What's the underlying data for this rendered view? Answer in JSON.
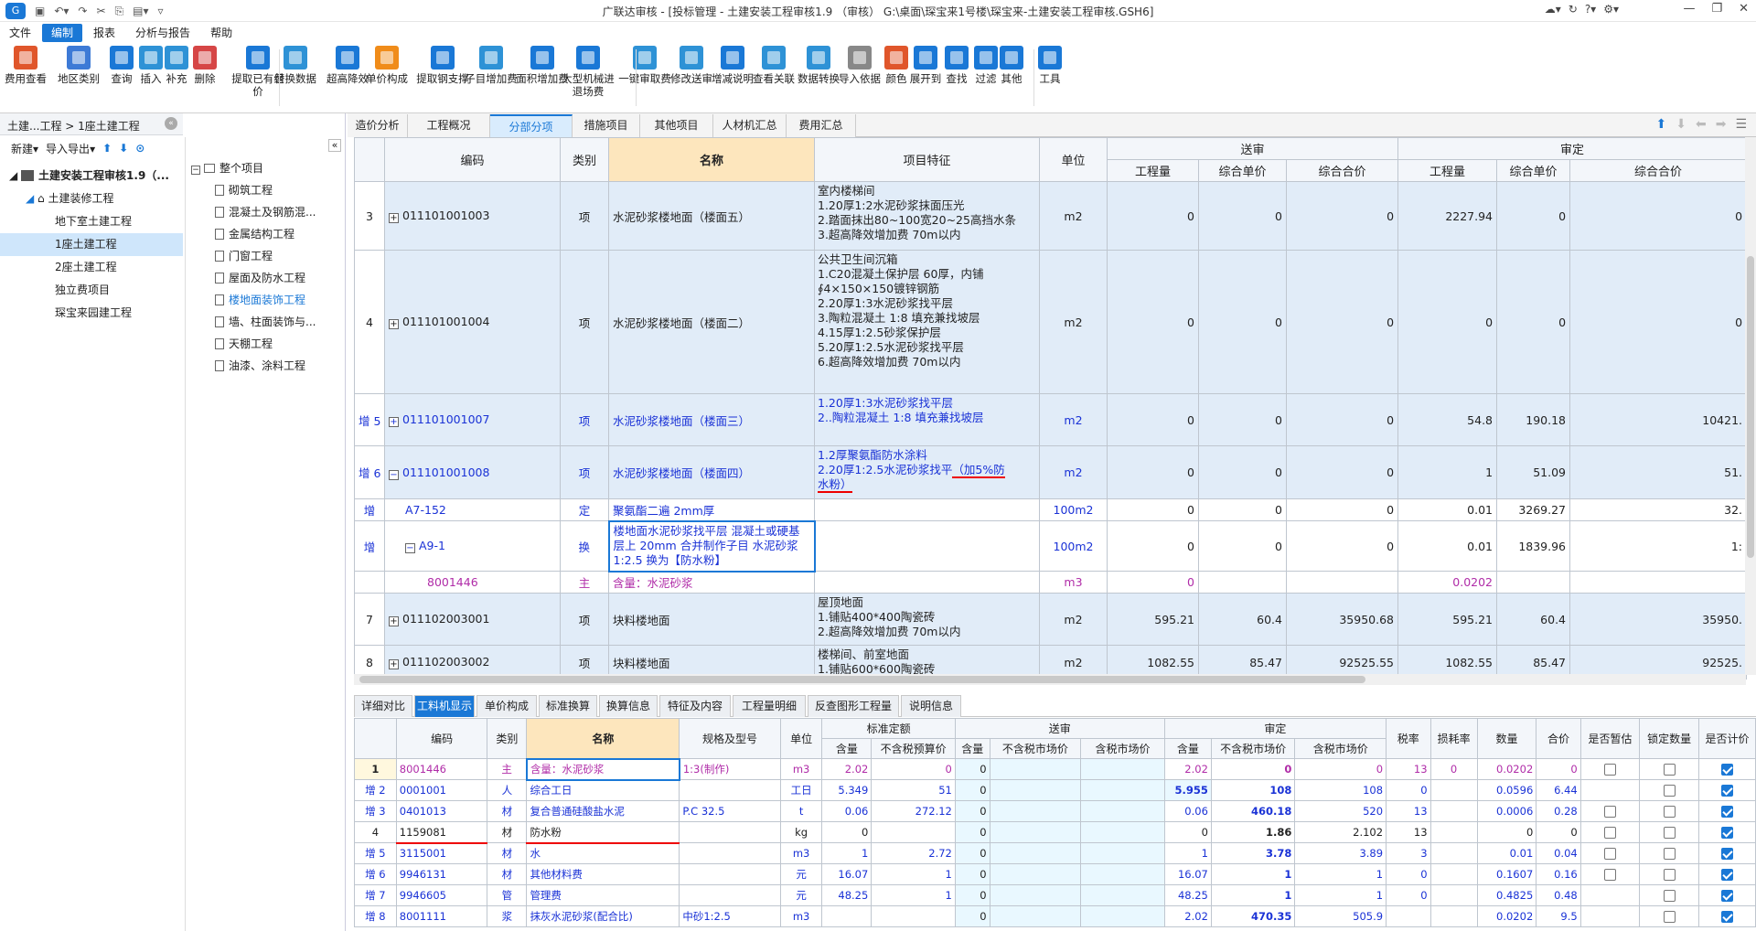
{
  "window": {
    "title": "广联达审核 - [投标管理 - 土建安装工程审核1.9 （审核） G:\\桌面\\琛宝来1号楼\\琛宝来-土建安装工程审核.GSH6]"
  },
  "menu": [
    "文件",
    "编制",
    "报表",
    "分析与报告",
    "帮助"
  ],
  "ribbon": [
    "费用查看",
    "地区类别",
    "查询",
    "插入",
    "补充",
    "删除",
    "提取已有组价",
    "替换数据",
    "超高降效",
    "单价构成",
    "提取钢支撑",
    "子目增加费",
    "面积增加费",
    "大型机械进退场费",
    "一键审取费",
    "修改送审",
    "增减说明",
    "查看关联",
    "数据转换",
    "导入依据",
    "颜色",
    "展开到",
    "查找",
    "过滤",
    "其他",
    "工具"
  ],
  "breadcrumb": "土建...工程 > 1座土建工程",
  "lefttool": {
    "new": "新建",
    "import": "导入导出"
  },
  "tree": [
    {
      "label": "土建安装工程审核1.9（...",
      "level": 0,
      "bold": true
    },
    {
      "label": "土建装修工程",
      "level": 1
    },
    {
      "label": "地下室土建工程",
      "level": 2
    },
    {
      "label": "1座土建工程",
      "level": 2,
      "sel": true
    },
    {
      "label": "2座土建工程",
      "level": 2
    },
    {
      "label": "独立费项目",
      "level": 2
    },
    {
      "label": "琛宝来园建工程",
      "level": 2
    }
  ],
  "tree2": [
    {
      "label": "整个项目",
      "root": true
    },
    {
      "label": "砌筑工程"
    },
    {
      "label": "混凝土及钢筋混..."
    },
    {
      "label": "金属结构工程"
    },
    {
      "label": "门窗工程"
    },
    {
      "label": "屋面及防水工程"
    },
    {
      "label": "楼地面装饰工程",
      "active": true
    },
    {
      "label": "墙、柱面装饰与..."
    },
    {
      "label": "天棚工程"
    },
    {
      "label": "油漆、涂料工程"
    }
  ],
  "tabs": [
    "造价分析",
    "工程概况",
    "分部分项",
    "措施项目",
    "其他项目",
    "人材机汇总",
    "费用汇总"
  ],
  "grid": {
    "headers": {
      "code": "编码",
      "type": "类别",
      "name": "名称",
      "feature": "项目特征",
      "unit": "单位",
      "sent": "送审",
      "approved": "审定",
      "qty": "工程量",
      "uprice": "综合单价",
      "total": "综合合价"
    },
    "rows": [
      {
        "no": "3",
        "code": "011101001003",
        "type": "项",
        "name": "水泥砂浆楼地面（楼面五）",
        "feature": "室内楼梯间\n1.20厚1:2水泥砂浆抹面压光\n2.踏面抹出80~100宽20~25高挡水条\n3.超高降效增加费 70m以内",
        "unit": "m2",
        "s": [
          "0",
          "0",
          "0"
        ],
        "a": [
          "2227.94",
          "0",
          "0"
        ]
      },
      {
        "no": "4",
        "code": "011101001004",
        "type": "项",
        "name": "水泥砂浆楼地面（楼面二）",
        "feature": "公共卫生间沉箱\n1.C20混凝土保护层 60厚，内铺\n∮4×150×150镀锌钢筋\n2.20厚1:3水泥砂浆找平层\n3.陶粒混凝土 1:8 填充兼找坡层\n4.15厚1:2.5砂浆保护层\n5.20厚1:2.5水泥砂浆找平层\n6.超高降效增加费 70m以内",
        "unit": "m2",
        "s": [
          "0",
          "0",
          "0"
        ],
        "a": [
          "0",
          "0",
          "0"
        ]
      },
      {
        "no": "增 5",
        "code": "011101001007",
        "type": "项",
        "name": "水泥砂浆楼地面（楼面三）",
        "feature": "1.20厚1:3水泥砂浆找平层\n2..陶粒混凝土 1:8 填充兼找坡层",
        "unit": "m2",
        "s": [
          "0",
          "0",
          "0"
        ],
        "a": [
          "54.8",
          "190.18",
          "10421."
        ]
      },
      {
        "no": "增 6",
        "code": "011101001008",
        "type": "项",
        "name": "水泥砂浆楼地面（楼面四）",
        "feature": "1.2厚聚氨酯防水涂料\n2.20厚1:2.5水泥砂浆找平（加5%防\n水粉）",
        "unit": "m2",
        "s": [
          "0",
          "0",
          "0"
        ],
        "a": [
          "1",
          "51.09",
          "51."
        ]
      },
      {
        "no": "增",
        "code": "A7-152",
        "type": "定",
        "name": "聚氨酯二遍 2mm厚",
        "feature": "",
        "unit": "100m2",
        "s": [
          "0",
          "0",
          "0"
        ],
        "a": [
          "0.01",
          "3269.27",
          "32."
        ]
      },
      {
        "no": "增",
        "code": "A9-1",
        "type": "换",
        "name": "楼地面水泥砂浆找平层 混凝土或硬基层上 20mm  合并制作子目 水泥砂浆 1:2.5  换为【防水粉】",
        "feature": "",
        "unit": "100m2",
        "s": [
          "0",
          "0",
          "0"
        ],
        "a": [
          "0.01",
          "1839.96",
          "1:"
        ]
      },
      {
        "no": "",
        "code": "8001446",
        "type": "主",
        "name": "含量：水泥砂浆",
        "feature": "",
        "unit": "m3",
        "s": [
          "0",
          "",
          ""
        ],
        "a": [
          "0.0202",
          "",
          ""
        ]
      },
      {
        "no": "7",
        "code": "011102003001",
        "type": "项",
        "name": "块料楼地面",
        "feature": "屋顶地面\n1.铺贴400*400陶瓷砖\n2.超高降效增加费 70m以内",
        "unit": "m2",
        "s": [
          "595.21",
          "60.4",
          "35950.68"
        ],
        "a": [
          "595.21",
          "60.4",
          "35950."
        ]
      },
      {
        "no": "8",
        "code": "011102003002",
        "type": "项",
        "name": "块料楼地面",
        "feature": "楼梯间、前室地面\n1.铺贴600*600陶瓷砖",
        "unit": "m2",
        "s": [
          "1082.55",
          "85.47",
          "92525.55"
        ],
        "a": [
          "1082.55",
          "85.47",
          "92525."
        ]
      }
    ]
  },
  "btabs": [
    "详细对比",
    "工料机显示",
    "单价构成",
    "标准换算",
    "换算信息",
    "特征及内容",
    "工程量明细",
    "反查图形工程量",
    "说明信息"
  ],
  "bgrid": {
    "headers": {
      "code": "编码",
      "type": "类别",
      "name": "名称",
      "spec": "规格及型号",
      "unit": "单位",
      "std": "标准定额",
      "sent": "送审",
      "appr": "审定",
      "qty": "含量",
      "ntprice": "不含税预算价",
      "ntm": "不含税市场价",
      "tm": "含税市场价",
      "tax": "税率",
      "loss": "损耗率",
      "amount": "数量",
      "sum": "合价",
      "temp": "是否暂估",
      "lock": "锁定数量",
      "calc": "是否计价"
    },
    "rows": [
      {
        "no": "1",
        "code": "8001446",
        "type": "主",
        "name": "含量：水泥砂浆",
        "spec": "1:3(制作)",
        "unit": "m3",
        "std": [
          "2.02",
          "0"
        ],
        "sent": [
          "0",
          "",
          ""
        ],
        "appr": [
          "2.02",
          "0",
          "0"
        ],
        "tax": "13",
        "loss": "0",
        "amount": "0.0202",
        "sum": "0",
        "temp": false,
        "lock": false,
        "calc": true,
        "style": "pur"
      },
      {
        "no": "增 2",
        "code": "0001001",
        "type": "人",
        "name": "综合工日",
        "spec": "",
        "unit": "工日",
        "std": [
          "5.349",
          "51"
        ],
        "sent": [
          "0",
          "",
          ""
        ],
        "appr": [
          "5.955",
          "108",
          "108"
        ],
        "tax": "0",
        "loss": "",
        "amount": "0.0596",
        "sum": "6.44",
        "temp": null,
        "lock": false,
        "calc": true,
        "style": "blue"
      },
      {
        "no": "增 3",
        "code": "0401013",
        "type": "材",
        "name": "复合普通硅酸盐水泥",
        "spec": "P.C 32.5",
        "unit": "t",
        "std": [
          "0.06",
          "272.12"
        ],
        "sent": [
          "0",
          "",
          ""
        ],
        "appr": [
          "0.06",
          "460.18",
          "520"
        ],
        "tax": "13",
        "loss": "",
        "amount": "0.0006",
        "sum": "0.28",
        "temp": false,
        "lock": false,
        "calc": true,
        "style": "blue"
      },
      {
        "no": "4",
        "code": "1159081",
        "type": "材",
        "name": "防水粉",
        "spec": "",
        "unit": "kg",
        "std": [
          "0",
          ""
        ],
        "sent": [
          "0",
          "",
          ""
        ],
        "appr": [
          "0",
          "1.86",
          "2.102"
        ],
        "tax": "13",
        "loss": "",
        "amount": "0",
        "sum": "0",
        "temp": false,
        "lock": false,
        "calc": true,
        "style": ""
      },
      {
        "no": "增 5",
        "code": "3115001",
        "type": "材",
        "name": "水",
        "spec": "",
        "unit": "m3",
        "std": [
          "1",
          "2.72"
        ],
        "sent": [
          "0",
          "",
          ""
        ],
        "appr": [
          "1",
          "3.78",
          "3.89"
        ],
        "tax": "3",
        "loss": "",
        "amount": "0.01",
        "sum": "0.04",
        "temp": false,
        "lock": false,
        "calc": true,
        "style": "blue"
      },
      {
        "no": "增 6",
        "code": "9946131",
        "type": "材",
        "name": "其他材料费",
        "spec": "",
        "unit": "元",
        "std": [
          "16.07",
          "1"
        ],
        "sent": [
          "0",
          "",
          ""
        ],
        "appr": [
          "16.07",
          "1",
          "1"
        ],
        "tax": "0",
        "loss": "",
        "amount": "0.1607",
        "sum": "0.16",
        "temp": false,
        "lock": false,
        "calc": true,
        "style": "blue"
      },
      {
        "no": "增 7",
        "code": "9946605",
        "type": "管",
        "name": "管理费",
        "spec": "",
        "unit": "元",
        "std": [
          "48.25",
          "1"
        ],
        "sent": [
          "0",
          "",
          ""
        ],
        "appr": [
          "48.25",
          "1",
          "1"
        ],
        "tax": "0",
        "loss": "",
        "amount": "0.4825",
        "sum": "0.48",
        "temp": null,
        "lock": false,
        "calc": true,
        "style": "blue"
      },
      {
        "no": "增 8",
        "code": "8001111",
        "type": "浆",
        "name": "抹灰水泥砂浆(配合比)",
        "spec": "中砂1:2.5",
        "unit": "m3",
        "std": [
          "",
          ""
        ],
        "sent": [
          "0",
          "",
          ""
        ],
        "appr": [
          "2.02",
          "470.35",
          "505.9"
        ],
        "tax": "",
        "loss": "",
        "amount": "0.0202",
        "sum": "9.5",
        "temp": null,
        "lock": false,
        "calc": true,
        "style": "blue"
      }
    ]
  }
}
